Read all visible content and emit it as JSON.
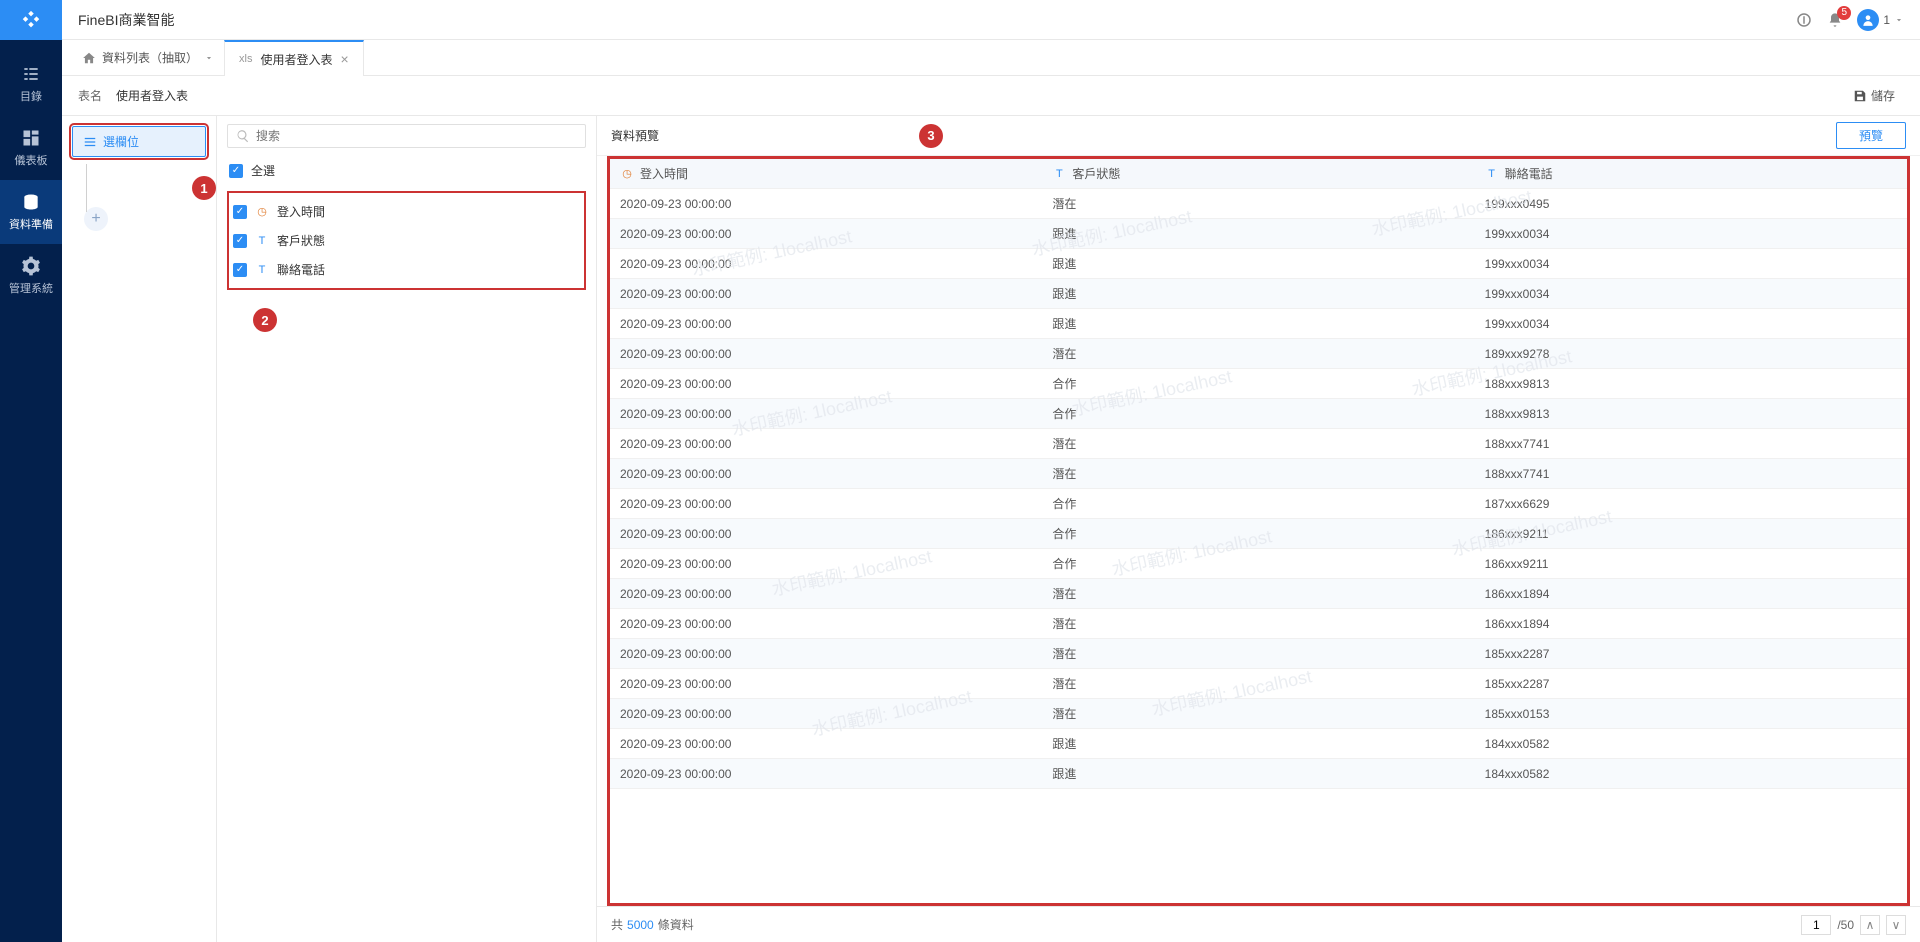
{
  "header": {
    "product_title": "FineBI商業智能",
    "notification_count": "5",
    "user_label": "1"
  },
  "rail": {
    "items": [
      {
        "label": "目錄"
      },
      {
        "label": "儀表板"
      },
      {
        "label": "資料準備"
      },
      {
        "label": "管理系統"
      }
    ]
  },
  "crumb": {
    "home": "資料列表（抽取）",
    "tab_type": "xls",
    "tab_label": "使用者登入表"
  },
  "name_bar": {
    "label": "表名",
    "value": "使用者登入表",
    "save": "儲存"
  },
  "tree": {
    "select_field_btn": "選欄位"
  },
  "fields": {
    "search_placeholder": "搜索",
    "select_all": "全選",
    "items": [
      {
        "type": "time",
        "label": "登入時間"
      },
      {
        "type": "text",
        "label": "客戶狀態"
      },
      {
        "type": "text",
        "label": "聯絡電話"
      }
    ]
  },
  "preview": {
    "title": "資料預覽",
    "button": "預覽",
    "columns": [
      {
        "type": "time",
        "label": "登入時間"
      },
      {
        "type": "text",
        "label": "客戶狀態"
      },
      {
        "type": "text",
        "label": "聯絡電話"
      }
    ],
    "rows": [
      [
        "2020-09-23 00:00:00",
        "潛在",
        "199xxx0495"
      ],
      [
        "2020-09-23 00:00:00",
        "跟進",
        "199xxx0034"
      ],
      [
        "2020-09-23 00:00:00",
        "跟進",
        "199xxx0034"
      ],
      [
        "2020-09-23 00:00:00",
        "跟進",
        "199xxx0034"
      ],
      [
        "2020-09-23 00:00:00",
        "跟進",
        "199xxx0034"
      ],
      [
        "2020-09-23 00:00:00",
        "潛在",
        "189xxx9278"
      ],
      [
        "2020-09-23 00:00:00",
        "合作",
        "188xxx9813"
      ],
      [
        "2020-09-23 00:00:00",
        "合作",
        "188xxx9813"
      ],
      [
        "2020-09-23 00:00:00",
        "潛在",
        "188xxx7741"
      ],
      [
        "2020-09-23 00:00:00",
        "潛在",
        "188xxx7741"
      ],
      [
        "2020-09-23 00:00:00",
        "合作",
        "187xxx6629"
      ],
      [
        "2020-09-23 00:00:00",
        "合作",
        "186xxx9211"
      ],
      [
        "2020-09-23 00:00:00",
        "合作",
        "186xxx9211"
      ],
      [
        "2020-09-23 00:00:00",
        "潛在",
        "186xxx1894"
      ],
      [
        "2020-09-23 00:00:00",
        "潛在",
        "186xxx1894"
      ],
      [
        "2020-09-23 00:00:00",
        "潛在",
        "185xxx2287"
      ],
      [
        "2020-09-23 00:00:00",
        "潛在",
        "185xxx2287"
      ],
      [
        "2020-09-23 00:00:00",
        "潛在",
        "185xxx0153"
      ],
      [
        "2020-09-23 00:00:00",
        "跟進",
        "184xxx0582"
      ],
      [
        "2020-09-23 00:00:00",
        "跟進",
        "184xxx0582"
      ]
    ]
  },
  "footer": {
    "prefix": "共",
    "count": "5000",
    "suffix": "條資料",
    "page": "1",
    "total_pages": "/50"
  },
  "watermark": "水印範例: 1localhost",
  "callouts": {
    "c1": "1",
    "c2": "2",
    "c3": "3"
  }
}
